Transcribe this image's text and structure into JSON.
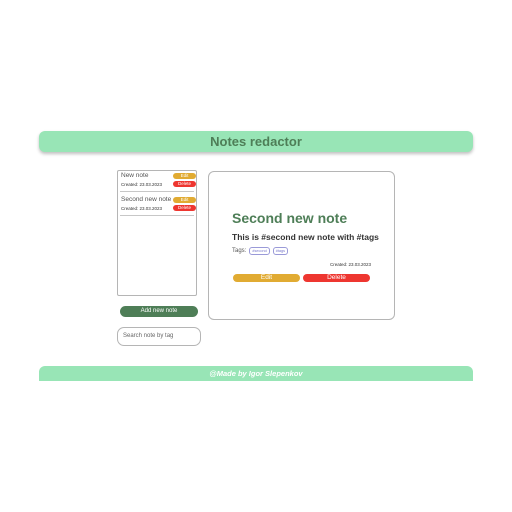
{
  "header": {
    "title": "Notes redactor"
  },
  "notes": [
    {
      "title": "New note",
      "created": "Created: 23.03.2023",
      "edit_label": "Edit",
      "delete_label": "Delete"
    },
    {
      "title": "Second new note",
      "created": "Created: 23.03.2023",
      "edit_label": "Edit",
      "delete_label": "Delete"
    }
  ],
  "sidebar": {
    "add_note_label": "Add new note",
    "search_placeholder": "Search note by tag"
  },
  "detail": {
    "title": "Second new note",
    "body": "This is #second new note with #tags",
    "tags_label": "Tags:",
    "tags": [
      "#second",
      "#tags"
    ],
    "created": "Created: 23.03.2023",
    "edit_label": "Edit",
    "delete_label": "Delete"
  },
  "footer": {
    "text": "@Made by Igor Slepenkov"
  },
  "colors": {
    "accent_green": "#98e5b6",
    "dark_green": "#4e7e57",
    "edit_orange": "#e1ab32",
    "delete_red": "#ee3630"
  }
}
